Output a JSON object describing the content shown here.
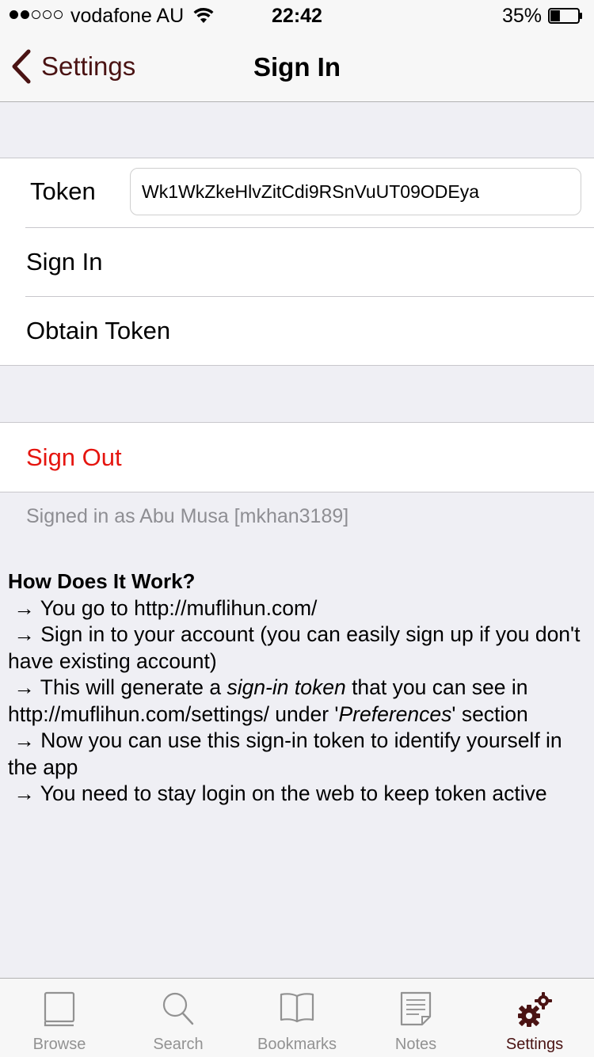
{
  "status_bar": {
    "carrier": "vodafone AU",
    "time": "22:42",
    "battery_percent": "35%",
    "battery_level": 0.35,
    "signal_bars": 2
  },
  "nav": {
    "back_label": "Settings",
    "title": "Sign In"
  },
  "token": {
    "label": "Token",
    "value": "Wk1WkZkeHlvZitCdi9RSnVuUT09ODEya"
  },
  "actions": {
    "sign_in": "Sign In",
    "obtain_token": "Obtain Token",
    "sign_out": "Sign Out"
  },
  "signed_in_note": "Signed in as Abu Musa [mkhan3189]",
  "help": {
    "title": "How Does It Work?",
    "arrow": "→",
    "step1": "You go to http://muflihun.com/",
    "step2": "Sign in to your account (you can easily sign up if you don't have existing account)",
    "step3_a": "This will generate a ",
    "step3_em": "sign-in token",
    "step3_b": " that you can see in http://muflihun.com/settings/ under '",
    "step3_em2": "Preferences",
    "step3_c": "' section",
    "step4": "Now you can use this sign-in token to identify yourself in the app",
    "step5": "You need to stay login on the web to keep token active"
  },
  "tabs": [
    {
      "label": "Browse",
      "icon": "book-icon"
    },
    {
      "label": "Search",
      "icon": "search-icon"
    },
    {
      "label": "Bookmarks",
      "icon": "open-book-icon"
    },
    {
      "label": "Notes",
      "icon": "note-icon"
    },
    {
      "label": "Settings",
      "icon": "gears-icon"
    }
  ],
  "colors": {
    "accent": "#4a1313",
    "destructive": "#e5150f",
    "background": "#efeff4"
  }
}
